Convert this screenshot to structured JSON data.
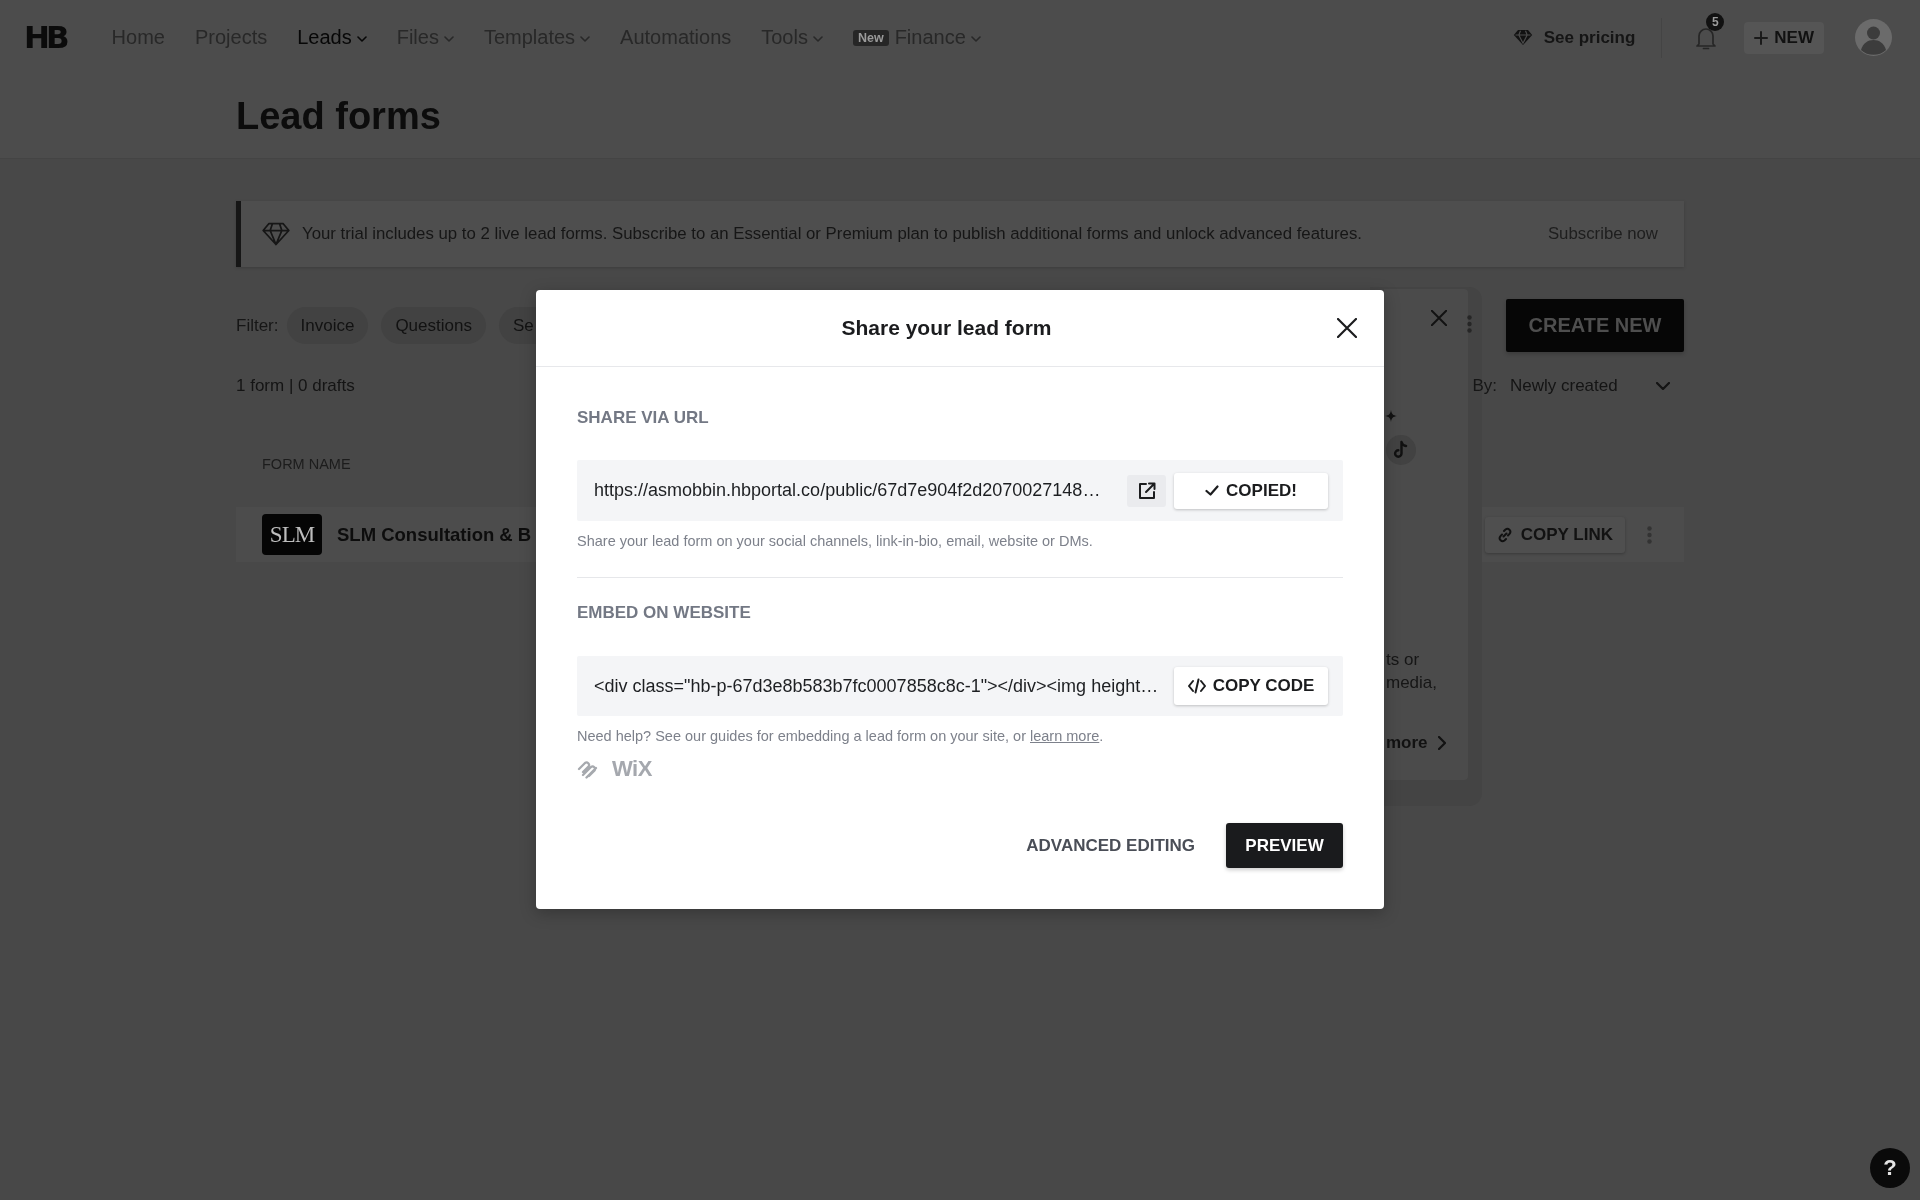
{
  "nav": {
    "logo": "HB",
    "items": [
      {
        "label": "Home",
        "selected": false,
        "dropdown": false
      },
      {
        "label": "Projects",
        "selected": false,
        "dropdown": false
      },
      {
        "label": "Leads",
        "selected": true,
        "dropdown": true
      },
      {
        "label": "Files",
        "selected": false,
        "dropdown": true
      },
      {
        "label": "Templates",
        "selected": false,
        "dropdown": true
      },
      {
        "label": "Automations",
        "selected": false,
        "dropdown": false
      },
      {
        "label": "Tools",
        "selected": false,
        "dropdown": true
      },
      {
        "label": "Finance",
        "badge": "New",
        "selected": false,
        "dropdown": true
      }
    ],
    "pricing": "See pricing",
    "notification_count": "5",
    "new_button": "NEW"
  },
  "page": {
    "title": "Lead forms"
  },
  "banner": {
    "text": "Your trial includes up to 2 live lead forms. Subscribe to an Essential or Premium plan to publish additional forms and unlock advanced features.",
    "action": "Subscribe now"
  },
  "filters": {
    "label": "Filter:",
    "chips": [
      "Invoice",
      "Questions",
      "Se"
    ]
  },
  "create_button": "CREATE NEW",
  "summary": "1 form | 0 drafts",
  "sort": {
    "label": "By:",
    "value": "Newly created"
  },
  "table": {
    "columns": [
      "FORM NAME"
    ],
    "rows": [
      {
        "logo": "SLM",
        "name": "SLM Consultation & B",
        "action": "COPY LINK"
      }
    ]
  },
  "popover": {
    "lines": [
      "ts or",
      "media,"
    ],
    "link": "more"
  },
  "modal": {
    "title": "Share your lead form",
    "sections": [
      {
        "kind": "url",
        "heading": "SHARE VIA URL",
        "value": "https://asmobbin.hbportal.co/public/67d7e904f2d2070027148…",
        "button": {
          "label": "COPIED!",
          "copied": true
        },
        "hint": "Share your lead form on your social channels, link-in-bio, email, website or DMs."
      },
      {
        "kind": "embed",
        "heading": "EMBED ON WEBSITE",
        "value": "<div class=\"hb-p-67d3e8b583b7fc0007858c8c-1\"></div><img height…",
        "button": {
          "label": "COPY CODE",
          "copied": false
        },
        "help": {
          "text": "Need help? See our guides for embedding a lead form on your site, or ",
          "link": "learn more",
          "after": "."
        },
        "platform_logo": "WiX"
      }
    ],
    "secondary_button": "ADVANCED EDITING",
    "primary_button": "PREVIEW"
  },
  "help_button": "?"
}
